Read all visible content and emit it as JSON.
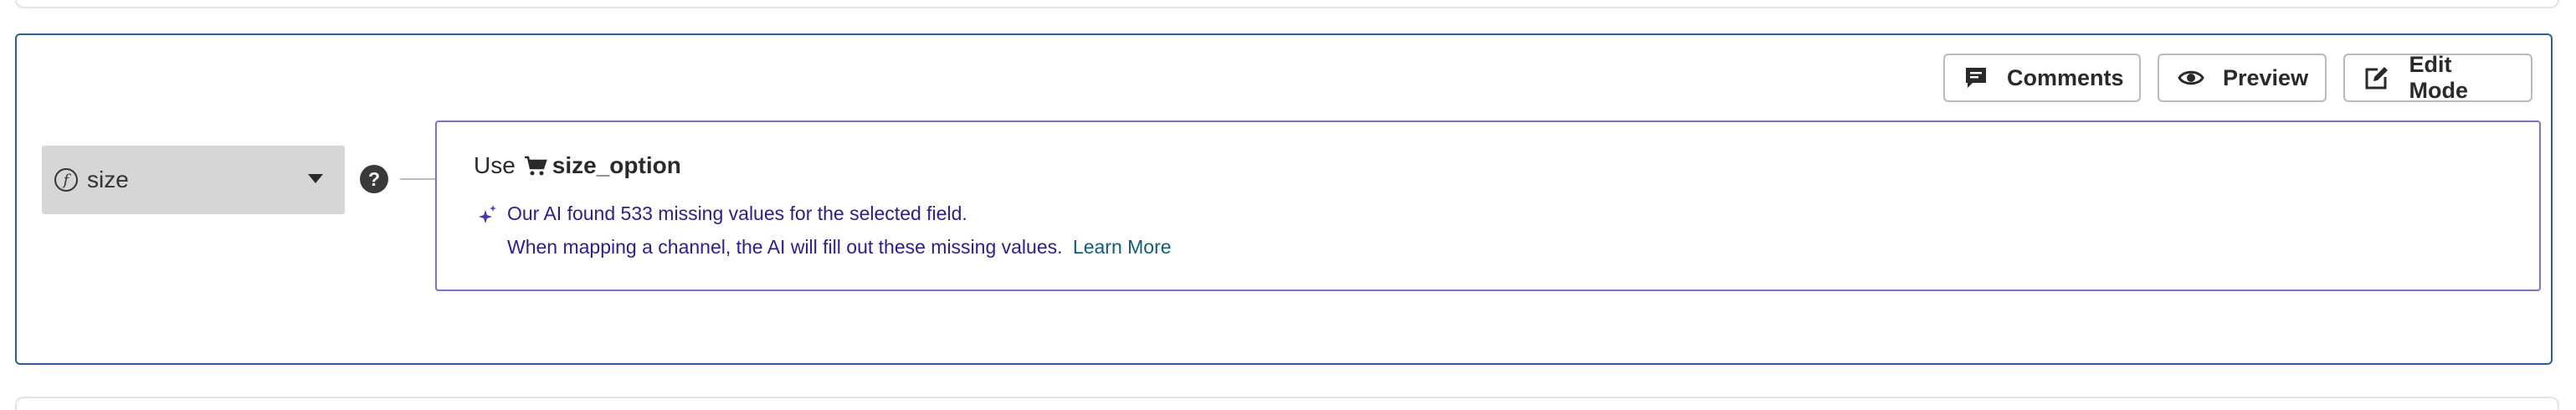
{
  "toolbar": {
    "comments_label": "Comments",
    "preview_label": "Preview",
    "edit_mode_label": "Edit Mode"
  },
  "field_select": {
    "value": "size",
    "icon": "function-icon"
  },
  "help": {
    "glyph": "?"
  },
  "suggestion": {
    "use_prefix": "Use",
    "field_icon": "cart-icon",
    "field_name": "size_option",
    "ai_message": "Our AI found 533 missing values for the selected field.",
    "ai_detail": "When mapping a channel, the AI will fill out these missing values.",
    "learn_more": "Learn More"
  },
  "colors": {
    "card_border": "#2d5e93",
    "suggestion_border": "#7b73c4",
    "ai_text": "#2b1f8a",
    "link": "#125c7a",
    "select_bg": "#d6d6d6"
  }
}
